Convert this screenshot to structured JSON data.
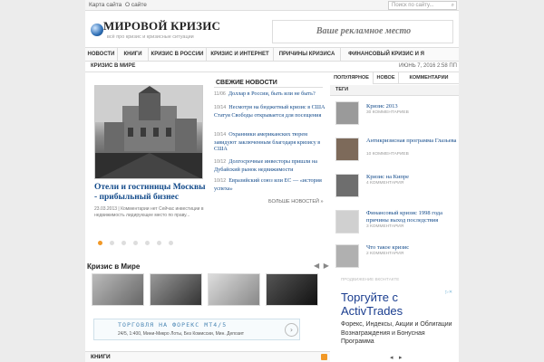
{
  "topbar": {
    "links": [
      "Карта сайта",
      "О сайте"
    ],
    "search_placeholder": "Поиск по сайту..."
  },
  "header": {
    "site_title": "МИРОВОЙ КРИЗИС",
    "tagline": "всё про кризис и кризисные ситуации",
    "ad_text": "Ваше рекламное место"
  },
  "nav": {
    "items": [
      "НОВОСТИ",
      "КНИГИ",
      "КРИЗИС В РОССИИ",
      "КРИЗИС И ИНТЕРНЕТ",
      "ПРИЧИНЫ КРИЗИСА",
      "ФИНАНСОВЫЙ КРИЗИС И Я"
    ],
    "sub_item": "КРИЗИС В МИРЕ",
    "date": "ИЮНЬ 7, 2016 2:58 ПП"
  },
  "slider": {
    "title": "Отели и гостиницы Москвы - прибыльный бизнес",
    "meta": "23.03.2013 | Комментарии нет Сейчас инвестиции в недвижимость лидирующее место по праву...",
    "dot_count": 7,
    "active_dot": 0
  },
  "fresh_news": {
    "heading": "СВЕЖИЕ НОВОСТИ",
    "items": [
      {
        "date": "11/06",
        "text": "Доллар в России, быть или не быть?"
      },
      {
        "date": "10/14",
        "text": "Несмотря на бюджетный кризис в США Статуя Свободы открывается для посещения"
      },
      {
        "date": "10/14",
        "text": "Охранники американских тюрем завидуют заключенным благодаря кризису в США"
      },
      {
        "date": "10/12",
        "text": "Долгосрочные инвесторы пришли на Дубайский рынок недвижимости"
      },
      {
        "date": "10/12",
        "text": "Евразийский союз или ЕС — «история успеха»"
      }
    ],
    "more": "БОЛЬШЕ НОВОСТЕЙ »"
  },
  "sidebar": {
    "tabs": [
      "ПОПУЛЯРНОЕ",
      "НОВОЕ",
      "КОММЕНТАРИИ"
    ],
    "tags_label": "ТЕГИ",
    "posts": [
      {
        "title": "Кризис 2013",
        "comments": "30 КОММЕНТАРИЕВ"
      },
      {
        "title": "Антикризисная программа Глазьева",
        "comments": "10 КОММЕНТАРИЕВ"
      },
      {
        "title": "Кризис на Кипре",
        "comments": "4 КОММЕНТАРИЯ"
      },
      {
        "title": "Финансовый кризис 1998 года причины выход последствия",
        "comments": "3 КОММЕНТАРИЯ"
      },
      {
        "title": "Что такое кризис",
        "comments": "2 КОММЕНТАРИЯ"
      }
    ],
    "ad_label": "ПРОДВИЖЕНИЕ ВКОНТАКТЕ"
  },
  "right_ad": {
    "headline": "Торгуйте с ActivTrades",
    "text": "Форекс, Индексы, Акции и Облигации Вознаграждения и Бонусная Программа",
    "adchoice": "▷✕"
  },
  "world_section": {
    "title": "Кризис в Мире",
    "prev": "◀",
    "next": "▶"
  },
  "banner_ad": {
    "headline": "ТОРГОВЛЯ НА ФОРЕКС МТ4/5",
    "text": "24/5, 1:400, Мини-Микро Лоты, Без Комиссии, Мин. Депозит",
    "go": "›"
  },
  "books": {
    "label": "КНИГИ"
  }
}
